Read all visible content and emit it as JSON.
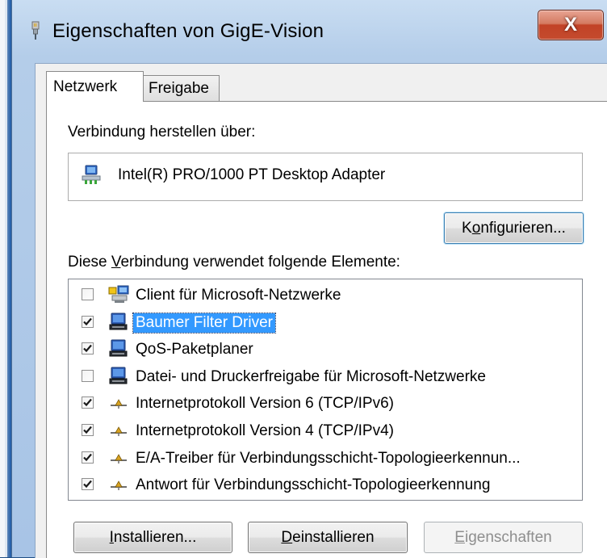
{
  "window": {
    "title": "Eigenschaften von GigE-Vision",
    "close_label": "X"
  },
  "tabs": [
    {
      "label": "Netzwerk",
      "active": true
    },
    {
      "label": "Freigabe",
      "active": false
    }
  ],
  "connection": {
    "label": "Verbindung herstellen über:",
    "adapter_name": "Intel(R) PRO/1000 PT Desktop Adapter",
    "adapter_icon": "network-adapter-icon",
    "configure_button": {
      "pre": "K",
      "accel": "o",
      "post": "nfigurieren..."
    }
  },
  "elements": {
    "label": {
      "pre": "Diese ",
      "accel": "V",
      "post": "erbindung verwendet folgende Elemente:"
    },
    "items": [
      {
        "label": "Client für Microsoft-Netzwerke",
        "checked": false,
        "selected": false,
        "icon": "network-client-icon"
      },
      {
        "label": "Baumer Filter Driver",
        "checked": true,
        "selected": true,
        "icon": "network-service-icon"
      },
      {
        "label": "QoS-Paketplaner",
        "checked": true,
        "selected": false,
        "icon": "network-service-icon"
      },
      {
        "label": "Datei- und Druckerfreigabe für Microsoft-Netzwerke",
        "checked": false,
        "selected": false,
        "icon": "network-service-icon"
      },
      {
        "label": "Internetprotokoll Version 6 (TCP/IPv6)",
        "checked": true,
        "selected": false,
        "icon": "protocol-icon"
      },
      {
        "label": "Internetprotokoll Version 4 (TCP/IPv4)",
        "checked": true,
        "selected": false,
        "icon": "protocol-icon"
      },
      {
        "label": "E/A-Treiber für Verbindungsschicht-Topologieerkennun...",
        "checked": true,
        "selected": false,
        "icon": "protocol-icon"
      },
      {
        "label": "Antwort für Verbindungsschicht-Topologieerkennung",
        "checked": true,
        "selected": false,
        "icon": "protocol-icon"
      }
    ]
  },
  "buttons": {
    "install": {
      "pre": "",
      "accel": "I",
      "post": "nstallieren..."
    },
    "uninstall": {
      "pre": "",
      "accel": "D",
      "post": "einstallieren"
    },
    "properties": {
      "pre": "",
      "accel": "E",
      "post": "igenschaften"
    }
  },
  "colors": {
    "selection": "#3399ff",
    "close_button": "#c24226"
  }
}
